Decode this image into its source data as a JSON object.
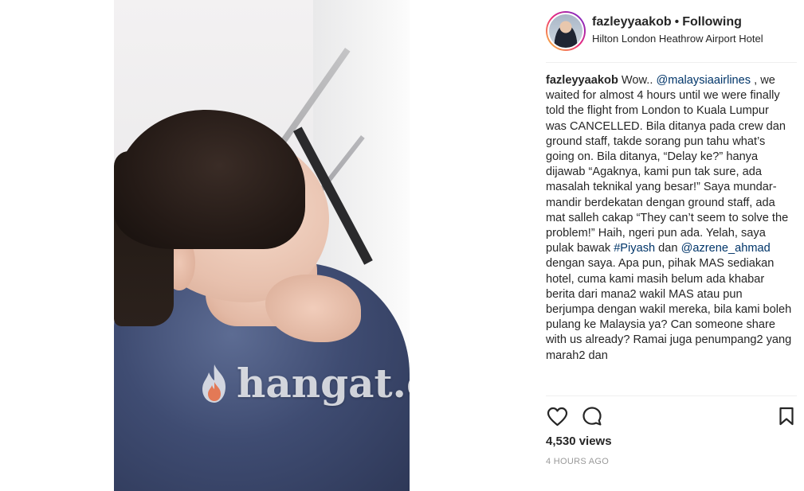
{
  "post": {
    "username": "fazleyyaakob",
    "separator": "•",
    "following_label": "Following",
    "location": "Hilton London Heathrow Airport Hotel",
    "media": {
      "watermark_text": "hangat.co",
      "icons": {
        "flame": "flame-icon"
      }
    },
    "caption": {
      "username": "fazleyyaakob",
      "part1": "Wow.. ",
      "mention1": "@malaysiaairlines",
      "part2": " , we waited for almost 4 hours until we were finally told the flight from London to Kuala Lumpur was CANCELLED. Bila ditanya pada crew dan ground staff, takde sorang pun tahu what’s going on. Bila ditanya, “Delay ke?” hanya dijawab “Agaknya, kami pun tak sure, ada masalah teknikal yang besar!” Saya mundar-mandir berdekatan dengan ground staff, ada mat salleh cakap “They can’t seem to solve the problem!” Haih, ngeri pun ada. Yelah, saya pulak bawak ",
      "hashtag1": "#Piyash",
      "part3": " dan ",
      "mention2": "@azrene_ahmad",
      "part4": " dengan saya. Apa pun, pihak MAS sediakan hotel, cuma kami masih belum ada khabar berita dari mana2 wakil MAS atau pun berjumpa dengan wakil mereka, bila kami boleh pulang ke Malaysia ya? Can someone share with us already? Ramai juga penumpang2 yang marah2 dan"
    },
    "actions": {
      "like": "heart-icon",
      "comment": "comment-bubble-icon",
      "save": "bookmark-icon"
    },
    "views": "4,530 views",
    "time_ago": "4 HOURS AGO"
  },
  "colors": {
    "text": "#262626",
    "link": "#003569",
    "muted": "#999999",
    "divider": "#efefef",
    "avatar_ring_start": "#f9ce34",
    "avatar_ring_mid": "#ee2a7b",
    "avatar_ring_end": "#6228d7"
  }
}
